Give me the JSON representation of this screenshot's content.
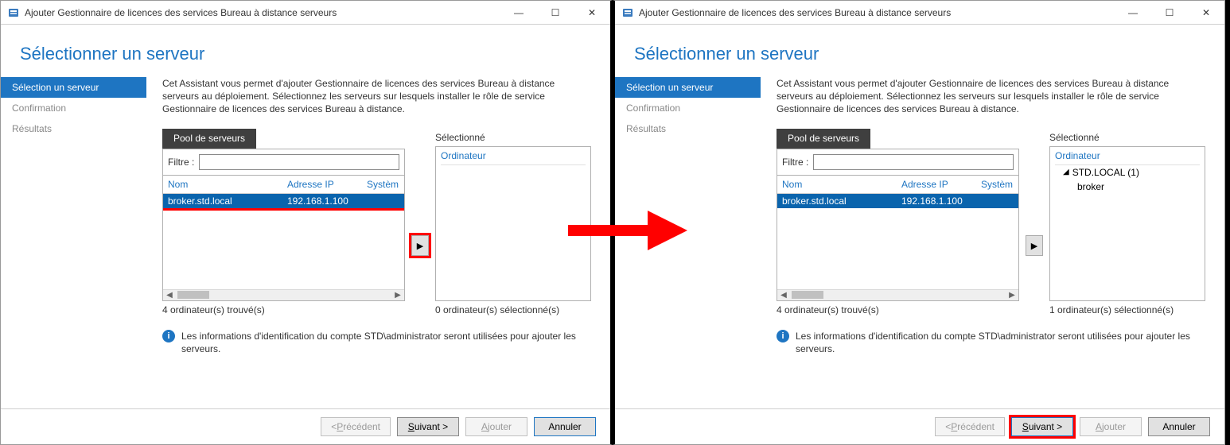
{
  "window": {
    "title": "Ajouter Gestionnaire de licences des services Bureau à distance serveurs"
  },
  "heading": "Sélectionner un serveur",
  "sidebar": {
    "items": [
      {
        "label": "Sélection un serveur",
        "active": true
      },
      {
        "label": "Confirmation",
        "active": false
      },
      {
        "label": "Résultats",
        "active": false
      }
    ]
  },
  "description": "Cet Assistant vous permet d'ajouter Gestionnaire de licences des services Bureau à distance serveurs au déploiement. Sélectionnez les serveurs sur lesquels installer le rôle de service Gestionnaire de licences des services Bureau à distance.",
  "pool": {
    "tab": "Pool de serveurs",
    "filter_label": "Filtre :",
    "filter_value": "",
    "columns": {
      "nom": "Nom",
      "ip": "Adresse IP",
      "sys": "Systèm"
    },
    "rows": [
      {
        "nom": "broker.std.local",
        "ip": "192.168.1.100",
        "sys": "",
        "selected": true
      }
    ],
    "count_label_left": "4 ordinateur(s) trouvé(s)"
  },
  "selected_list": {
    "label": "Sélectionné",
    "header": "Ordinateur",
    "count_left": "0 ordinateur(s) sélectionné(s)",
    "count_right": "1 ordinateur(s) sélectionné(s)",
    "tree_group": "STD.LOCAL (1)",
    "tree_leaf": "broker"
  },
  "info_text": "Les informations d'identification du compte STD\\administrator seront utilisées pour ajouter les serveurs.",
  "buttons": {
    "prev": "< Précédent",
    "next": "Suivant >",
    "add": "Ajouter",
    "cancel": "Annuler"
  },
  "icons": {
    "app": "server-manager",
    "minimize": "—",
    "maximize": "☐",
    "close": "✕",
    "arrow_right": "▶",
    "arrow_left": "◀",
    "caret": "▸",
    "caret_down": "◢"
  }
}
